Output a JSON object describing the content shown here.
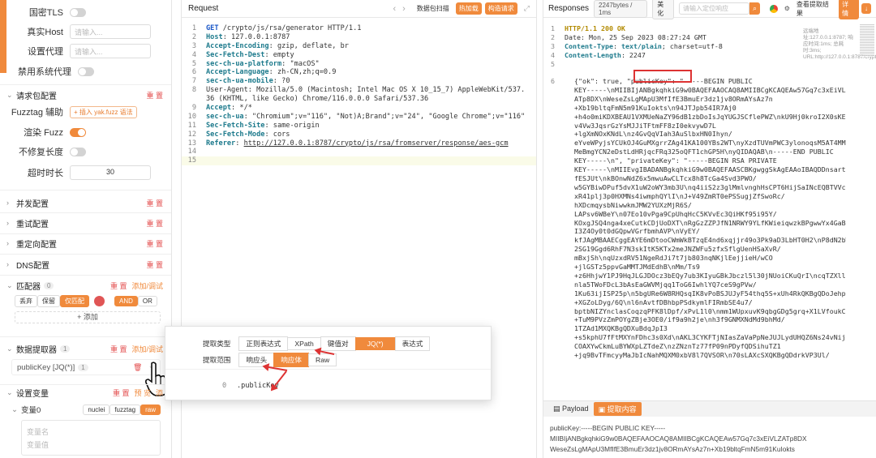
{
  "left": {
    "rows": [
      {
        "label": "国密TLS",
        "type": "toggle",
        "on": false
      },
      {
        "label": "真实Host",
        "type": "input",
        "placeholder": "请输入..."
      },
      {
        "label": "设置代理",
        "type": "input",
        "placeholder": "请输入..."
      },
      {
        "label": "禁用系统代理",
        "type": "toggle",
        "on": false
      }
    ],
    "request_config": {
      "title": "请求包配置",
      "reset": "重 置"
    },
    "fuzztag": {
      "label": "Fuzztag 辅助",
      "button": "+ 插入 yak.fuzz 语法"
    },
    "render_fuzz": {
      "label": "渲染 Fuzz",
      "on": true
    },
    "no_fix_length": {
      "label": "不修复长度",
      "on": false
    },
    "timeout": {
      "label": "超时时长",
      "value": "30"
    },
    "sections": [
      {
        "title": "并发配置",
        "reset": "重 置"
      },
      {
        "title": "重试配置",
        "reset": "重 置"
      },
      {
        "title": "重定向配置",
        "reset": "重 置"
      },
      {
        "title": "DNS配置",
        "reset": "重 置"
      }
    ],
    "matcher": {
      "title": "匹配器",
      "count": "0",
      "reset": "重 置",
      "add": "添加/调试",
      "buttons": [
        "丢弃",
        "保留",
        "仅匹配"
      ],
      "logic": [
        "AND",
        "OR"
      ],
      "add_button": "+ 添加"
    },
    "extractor": {
      "title": "数据提取器",
      "count": "1",
      "reset": "重 置",
      "add": "添加/调试",
      "item": "publicKey [JQ(*)]",
      "item_count": "1"
    },
    "variables": {
      "title": "设置变量",
      "reset": "重 置",
      "preview": "预 览",
      "add": "添",
      "var_label": "变量0",
      "tabs": [
        "nuclei",
        "fuzztag",
        "raw"
      ],
      "name_placeholder": "变量名",
      "value_placeholder": "变量值"
    }
  },
  "request": {
    "title": "Request",
    "actions": [
      "数据包扫描",
      "热加载",
      "构造请求"
    ],
    "lines": [
      {
        "n": "1",
        "parts": [
          [
            "meth",
            "GET"
          ],
          [
            "t",
            " /crypto/js/rsa/generator HTTP/1.1"
          ]
        ]
      },
      {
        "n": "2",
        "parts": [
          [
            "hk",
            "Host"
          ],
          [
            "t",
            ": 127.0.0.1:8787"
          ]
        ]
      },
      {
        "n": "3",
        "parts": [
          [
            "hk",
            "Accept-Encoding"
          ],
          [
            "t",
            ": gzip, deflate, br"
          ]
        ]
      },
      {
        "n": "4",
        "parts": [
          [
            "hk",
            "Sec-Fetch-Dest"
          ],
          [
            "t",
            ": empty"
          ]
        ]
      },
      {
        "n": "5",
        "parts": [
          [
            "hk",
            "sec-ch-ua-platform"
          ],
          [
            "t",
            ": \"macOS\""
          ]
        ]
      },
      {
        "n": "6",
        "parts": [
          [
            "hk",
            "Accept-Language"
          ],
          [
            "t",
            ": zh-CN,zh;q=0.9"
          ]
        ]
      },
      {
        "n": "7",
        "parts": [
          [
            "hk",
            "sec-ch-ua-mobile"
          ],
          [
            "t",
            ": ?0"
          ]
        ]
      },
      {
        "n": "8",
        "parts": [
          [
            "t",
            "User-Agent: Mozilla/5.0 (Macintosh; Intel Mac OS X 10_15_7) AppleWebKit/537."
          ]
        ]
      },
      {
        "n": "",
        "parts": [
          [
            "t",
            "36 (KHTML, like Gecko) Chrome/116.0.0.0 Safari/537.36"
          ]
        ]
      },
      {
        "n": "9",
        "parts": [
          [
            "hk",
            "Accept"
          ],
          [
            "t",
            ": */*"
          ]
        ]
      },
      {
        "n": "10",
        "parts": [
          [
            "hk",
            "sec-ch-ua"
          ],
          [
            "t",
            ": \"Chromium\";v=\"116\", \"Not)A;Brand\";v=\"24\", \"Google Chrome\";v=\"116\""
          ]
        ]
      },
      {
        "n": "11",
        "parts": [
          [
            "hk",
            "Sec-Fetch-Site"
          ],
          [
            "t",
            ": same-origin"
          ]
        ]
      },
      {
        "n": "12",
        "parts": [
          [
            "hk",
            "Sec-Fetch-Mode"
          ],
          [
            "t",
            ": cors"
          ]
        ]
      },
      {
        "n": "13",
        "parts": [
          [
            "hk",
            "Referer"
          ],
          [
            "t",
            ": "
          ],
          [
            "url",
            "http://127.0.0.1:8787/crypto/js/rsa/fromserver/response/aes-gcm"
          ]
        ]
      },
      {
        "n": "14",
        "parts": [
          [
            "t",
            ""
          ]
        ]
      },
      {
        "n": "15",
        "parts": [
          [
            "t",
            ""
          ]
        ]
      }
    ]
  },
  "response": {
    "title": "Responses",
    "size": "2247bytes / 1ms",
    "beautify": "美化",
    "search_placeholder": "请输入定位响应",
    "view_result": "查看提取结果",
    "detail": "详 情",
    "side_note": "远端地址:127.0.0.1:8787; 响应时间:1ms; 总耗时:3ms; URL:http://127.0.0.1:8787/crypto/j...",
    "lines": [
      {
        "n": "1",
        "parts": [
          [
            "st",
            "HTTP/1.1 200 OK"
          ]
        ]
      },
      {
        "n": "2",
        "parts": [
          [
            "t",
            "Date: Mon, 25 Sep 2023 08:27:24 GMT"
          ]
        ]
      },
      {
        "n": "3",
        "parts": [
          [
            "rk",
            "Content-Type"
          ],
          [
            "t",
            ": "
          ],
          [
            "b",
            "text/plain"
          ],
          [
            "t",
            "; charset=utf-8"
          ]
        ]
      },
      {
        "n": "4",
        "parts": [
          [
            "rk",
            "Content-Length"
          ],
          [
            "t",
            ": 2247"
          ]
        ]
      },
      {
        "n": "5",
        "parts": [
          [
            "t",
            ""
          ]
        ]
      }
    ],
    "body_line_no": "6",
    "body": "{\"ok\": true, \"publicKey\": \"-----BEGIN PUBLIC \nKEY-----\\nMIIBIjANBgkqhkiG9w0BAQEFAAOCAQ8AMIIBCgKCAQEAw57Gq7c3xEiVLZ\nATp8DX\\nWeseZsLgMApU3MfIfE3BmuEr3dz1jv8ORmAYsAz7n\n+Xb19bltqFmN5m91KuIokts\\n94JTJpb54IR7Aj0\n+h4o0miKDXBEAU1VXMUeNaZY96dB1zbDoIsJqYUGJSCflePWZ\\nkU9Hj0kroI2X0sKEQ\nv4Vw3JqsrGzYsMJJiTFtmFF8zI0ekvywD7L\n+lgXmNOxKNdL\\nz4GvQqVIah3AuSlbxHN0Ihyn/\neYveWPyjsYCUkOJ4GuMXgrrZAg41KA100YBs2WT\\nyXzdTUVmPWC3ylonoqsM5AT4MMG\nMeBmgYCN2eDstLdHRjqcFRq325oQFT1chGP5H\\nyQIDAQAB\\n-----END PUBLIC \nKEY-----\\n\", \"privateKey\": \"-----BEGIN RSA PRIVATE \nKEY-----\\nMIIEvgIBADANBgkqhkiG9w0BAQEFAASCBKgwggSkAgEAAoIBAQDDnsartz\nfESJUt\\nkBOnwNdZ6x5mwuAwCLTcx8h8TcGa4Svd3PWO/\nw5GYBiwDPuf5dvX1uW2oWY3mb3U\\nq4iiS2z3glMmlvnghHsCPT6HijSaINcEQBTVVc\nxR41plj3p0HXMNs4iwmphQYlI\\nJ+V49ZmRT0ePSSugjZfSwoRc/\nhXDcmqysbNiwwkmJMW2YUXzMjR6S/\nLAPsv6WBeY\\n07Eo10vPga9CpUhqHcC5KVvEc3QiHKf95i95Y/\nKOxgJSQ4nga4xeCutkCDjUoDXT\\nRgGzZZPJfN1NRWY9YLfKWieiqwzkBPgwwYx4GaBg\nI3Z4Oy0t0dGQpwVGrfbmhAVP\\nVyEY/\nkfJAgMBAAECggEAYE6mDtooCWmWkBTzqE4nd6xqjjr49o3Pk9aD3LbHT0H2\\nP8dN2bW\n2SG19Ggd6RhF7N3skItK5KTx2meJNZWFu5zfxSflgUenHSaXvR/\nmBxjSh\\nqUzxdRV51NgeRdJi7t7jb803nqNKjlEejjieH/wCO\n+jlGSTz5ppvGaMMTJMdEdhB\\nMm/Ts9\n+z6HhjwY1PJ9HqJLGJDOcz3bEQy7ub3KIyuGBkJbczl5l30jNUoiCKuQrI\\ncqTZXllg\nnla5TWoFDcL3bAsEaGWVMjqq1ToG6IwhlYQ7ceS9gPVw/\n1Ku63ijISP25p\\n5bgURe6W8RHQsqIK8vPoBSJUJyF54thq5S+xUh4RkQKBgQDoJehp\n+XGZoLDyg/6Q\\nl6nAvtfDBhbpPSdkymlFIRmbSE4u7/\nbptbNIZYnclasCoqzqPFK8lDpf/xPvL1l0\\nmm1WUpxuvK9qbgGDg5grq+X1LVfoukCt\n+TuM9PVzZmPOYgZBje3OE0/if9a9h2je\\nh3f9GNMXNdMd9bhMd/\n1TZAd1MXQKBgQDXuBdqJpI3\n+s5kphU7fFtMXYnFDhc3s0Xd\\nAKL3CYKFTjNIasZaVaPpNeJUJLydUHQZ6Ns24vNijtC\nCOAXYwCkmLuBYWXpLZTdeZ\\nzZNznTz77fP09nPDyfQDSihuTZ1\n+jq9BvTFmcyyMaJbIcNahMQXM0xbV8l7QVSOR\\n70sLAXcSXQKBgQDdrkVP3Ul/",
    "bottom_tabs": [
      "Payload",
      "提取内容"
    ],
    "extract_text": "publicKey:-----BEGIN PUBLIC KEY-----\nMIIBIjANBgkqhkiG9w0BAQEFAAOCAQ8AMIIBCgKCAQEAw57Gq7c3xEiVLZATp8DX\nWeseZsLgMApU3MfIfE3BmuEr3dz1jv8ORmAYsAz7n+Xb19bltqFmN5m91KuIokts"
  },
  "popup": {
    "type_label": "提取类型",
    "types": [
      "正则表达式",
      "XPath",
      "键值对",
      "JQ(*)",
      "表达式"
    ],
    "active_type": "JQ(*)",
    "scope_label": "提取范围",
    "scopes": [
      "响应头",
      "响应体",
      "Raw"
    ],
    "active_scope": "响应体",
    "expr_line": "0",
    "expr": ".publicKey"
  },
  "colors": {
    "accent": "#f08a3c",
    "annotation": "#dd3333",
    "header_key": "#1d7a8c",
    "status": "#b28a00"
  }
}
